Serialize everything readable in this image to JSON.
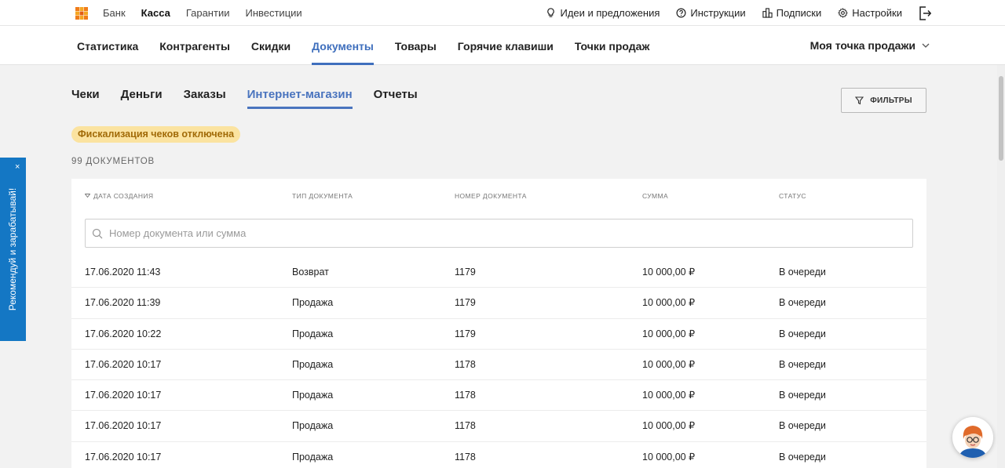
{
  "topbar": {
    "links": [
      {
        "label": "Банк",
        "active": false
      },
      {
        "label": "Касса",
        "active": true
      },
      {
        "label": "Гарантии",
        "active": false
      },
      {
        "label": "Инвестиции",
        "active": false
      }
    ],
    "right": {
      "ideas": "Идеи и предложения",
      "instructions": "Инструкции",
      "subscriptions": "Подписки",
      "settings": "Настройки"
    }
  },
  "mainnav": {
    "items": [
      {
        "label": "Статистика",
        "active": false
      },
      {
        "label": "Контрагенты",
        "active": false
      },
      {
        "label": "Скидки",
        "active": false
      },
      {
        "label": "Документы",
        "active": true
      },
      {
        "label": "Товары",
        "active": false
      },
      {
        "label": "Горячие клавиши",
        "active": false
      },
      {
        "label": "Точки продаж",
        "active": false
      }
    ],
    "point_select": "Моя точка продажи"
  },
  "subtabs": [
    {
      "label": "Чеки",
      "active": false
    },
    {
      "label": "Деньги",
      "active": false
    },
    {
      "label": "Заказы",
      "active": false
    },
    {
      "label": "Интернет-магазин",
      "active": true
    },
    {
      "label": "Отчеты",
      "active": false
    }
  ],
  "filters_label": "ФИЛЬТРЫ",
  "badge": "Фискализация чеков отключена",
  "doc_count": "99 ДОКУМЕНТОВ",
  "table": {
    "headers": {
      "date": "ДАТА СОЗДАНИЯ",
      "type": "ТИП ДОКУМЕНТА",
      "number": "НОМЕР ДОКУМЕНТА",
      "sum": "СУММА",
      "status": "СТАТУС"
    },
    "search_placeholder": "Номер документа или сумма",
    "rows": [
      {
        "date": "17.06.2020 11:43",
        "type": "Возврат",
        "number": "1179",
        "sum": "10 000,00 ₽",
        "status": "В очереди"
      },
      {
        "date": "17.06.2020 11:39",
        "type": "Продажа",
        "number": "1179",
        "sum": "10 000,00 ₽",
        "status": "В очереди"
      },
      {
        "date": "17.06.2020 10:22",
        "type": "Продажа",
        "number": "1179",
        "sum": "10 000,00 ₽",
        "status": "В очереди"
      },
      {
        "date": "17.06.2020 10:17",
        "type": "Продажа",
        "number": "1178",
        "sum": "10 000,00 ₽",
        "status": "В очереди"
      },
      {
        "date": "17.06.2020 10:17",
        "type": "Продажа",
        "number": "1178",
        "sum": "10 000,00 ₽",
        "status": "В очереди"
      },
      {
        "date": "17.06.2020 10:17",
        "type": "Продажа",
        "number": "1178",
        "sum": "10 000,00 ₽",
        "status": "В очереди"
      },
      {
        "date": "17.06.2020 10:17",
        "type": "Продажа",
        "number": "1178",
        "sum": "10 000,00 ₽",
        "status": "В очереди"
      }
    ]
  },
  "promo": {
    "label": "Рекомендуй и зарабатывай!",
    "close": "×"
  },
  "colors": {
    "accent": "#3f6fbd",
    "badge_bg": "#fbe3a0",
    "badge_text": "#a16a07",
    "promo_bg": "#1477c4"
  }
}
